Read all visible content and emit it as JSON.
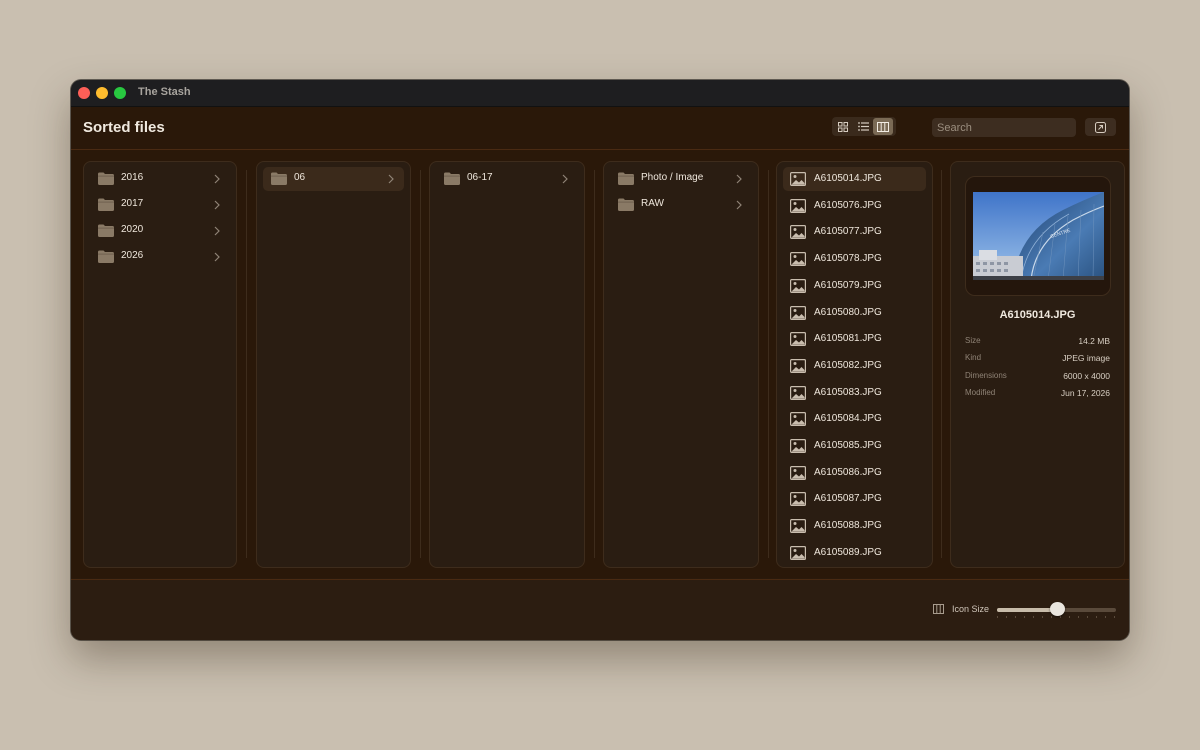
{
  "window": {
    "title": "The Stash"
  },
  "toolbar": {
    "page_title": "Sorted files",
    "view_modes": [
      "grid-view",
      "list-view",
      "column-view"
    ],
    "active_view": "column-view",
    "search_placeholder": "Search",
    "search_value": ""
  },
  "columns": [
    {
      "items": [
        {
          "label": "2016",
          "icon": "folder-icon",
          "has_children": true
        },
        {
          "label": "2017",
          "icon": "folder-icon",
          "has_children": true
        },
        {
          "label": "2020",
          "icon": "folder-icon",
          "has_children": true
        },
        {
          "label": "2026",
          "icon": "folder-icon",
          "has_children": true
        }
      ]
    },
    {
      "items": [
        {
          "label": "06",
          "icon": "folder-icon",
          "has_children": true,
          "selected": true
        }
      ]
    },
    {
      "items": [
        {
          "label": "06-17",
          "icon": "folder-icon",
          "has_children": true
        }
      ]
    },
    {
      "items": [
        {
          "label": "Photo / Image",
          "icon": "folder-icon",
          "has_children": true
        },
        {
          "label": "RAW",
          "icon": "folder-icon",
          "has_children": true
        }
      ]
    }
  ],
  "files": {
    "icon": "image-file-icon",
    "selected": "A6105014.JPG",
    "items": [
      "A6105014.JPG",
      "A6105076.JPG",
      "A6105077.JPG",
      "A6105078.JPG",
      "A6105079.JPG",
      "A6105080.JPG",
      "A6105081.JPG",
      "A6105082.JPG",
      "A6105083.JPG",
      "A6105084.JPG",
      "A6105085.JPG",
      "A6105086.JPG",
      "A6105087.JPG",
      "A6105088.JPG",
      "A6105089.JPG"
    ]
  },
  "preview": {
    "filename": "A6105014.JPG",
    "meta": [
      {
        "key": "Size",
        "value": "14.2 MB"
      },
      {
        "key": "Kind",
        "value": "JPEG image"
      },
      {
        "key": "Dimensions",
        "value": "6000 x 4000"
      },
      {
        "key": "Modified",
        "value": "Jun 17, 2026"
      }
    ]
  },
  "statusbar": {
    "icon_size_label": "Icon Size",
    "icon_size_value": 0.5
  },
  "colors": {
    "accent": "#7a6a55",
    "folder": "#8a7a66",
    "background": "#2a1809"
  }
}
